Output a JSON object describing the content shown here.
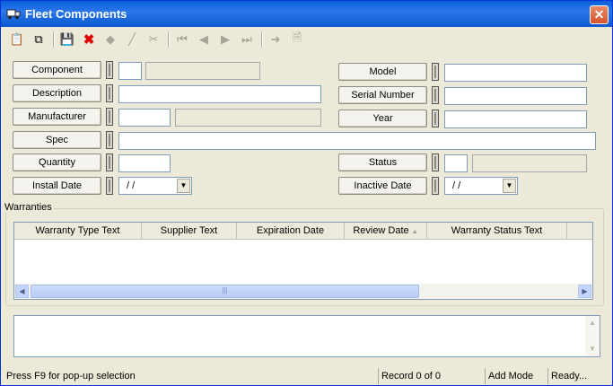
{
  "window": {
    "title": "Fleet Components",
    "close_label": "✕"
  },
  "toolbar": {
    "buttons": [
      {
        "name": "copy-icon",
        "glyph": "📋"
      },
      {
        "name": "paste-icon",
        "glyph": "⧉"
      },
      {
        "name": "save-icon",
        "glyph": "💾"
      },
      {
        "name": "delete-icon",
        "glyph": "✖"
      },
      {
        "name": "eraser-icon",
        "glyph": "◆"
      },
      {
        "name": "pencil-icon",
        "glyph": "╱"
      },
      {
        "name": "scissors-icon",
        "glyph": "✂"
      },
      {
        "name": "first-record-icon",
        "glyph": "⏮"
      },
      {
        "name": "previous-record-icon",
        "glyph": "◀"
      },
      {
        "name": "next-record-icon",
        "glyph": "▶"
      },
      {
        "name": "last-record-icon",
        "glyph": "⏭"
      },
      {
        "name": "goto-icon",
        "glyph": "➜"
      },
      {
        "name": "export-icon",
        "glyph": "🗎"
      }
    ]
  },
  "form": {
    "component": {
      "label": "Component",
      "code": "",
      "name": ""
    },
    "description": {
      "label": "Description",
      "value": ""
    },
    "manufacturer": {
      "label": "Manufacturer",
      "code": "",
      "name": ""
    },
    "spec": {
      "label": "Spec",
      "value": ""
    },
    "quantity": {
      "label": "Quantity",
      "value": ""
    },
    "install_date": {
      "label": "Install Date",
      "value": " / /"
    },
    "model": {
      "label": "Model",
      "value": ""
    },
    "serial_number": {
      "label": "Serial Number",
      "value": ""
    },
    "year": {
      "label": "Year",
      "value": ""
    },
    "status": {
      "label": "Status",
      "code": "",
      "name": ""
    },
    "inactive_date": {
      "label": "Inactive Date",
      "value": " / /"
    }
  },
  "warranties": {
    "legend": "Warranties",
    "columns": [
      "Warranty Type Text",
      "Supplier Text",
      "Expiration Date",
      "Review Date",
      "Warranty Status Text"
    ],
    "sorted_column_indicator": "▲",
    "rows": []
  },
  "statusbar": {
    "hint": "Press F9 for pop-up selection",
    "record": "Record 0 of 0",
    "mode": "Add Mode",
    "state": "Ready..."
  },
  "colors": {
    "title_bar": "#0a5fd8",
    "window_bg": "#ece9d8",
    "delete_red": "#e00000",
    "save_blue": "#1030a0"
  }
}
